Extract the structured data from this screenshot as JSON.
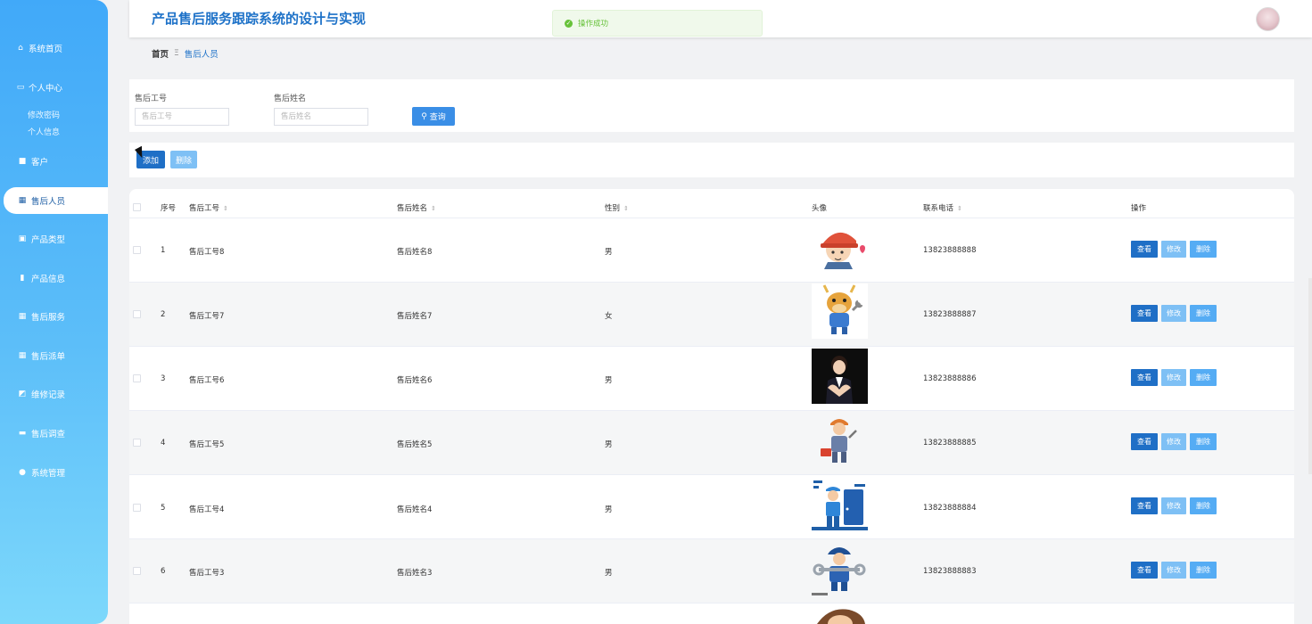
{
  "sidebar": {
    "home": "系统首页",
    "personal_center": "个人中心",
    "sub_items": [
      "修改密码",
      "个人信息"
    ],
    "items": [
      "客户",
      "售后人员",
      "产品类型",
      "产品信息",
      "售后服务",
      "售后派单",
      "维修记录",
      "售后调查",
      "系统管理"
    ],
    "active": "售后人员"
  },
  "header": {
    "title": "产品售后服务跟踪系统的设计与实现"
  },
  "toast": {
    "message": "操作成功"
  },
  "breadcrumb": {
    "home": "首页",
    "separator": "Ξ",
    "current": "售后人员"
  },
  "search": {
    "id_label": "售后工号",
    "id_placeholder": "售后工号",
    "id_value": "",
    "name_label": "售后姓名",
    "name_placeholder": "售后姓名",
    "name_value": "",
    "query_label": "查询"
  },
  "actions": {
    "add_label": "添加",
    "delete_label": "删除"
  },
  "table": {
    "columns": [
      "序号",
      "售后工号",
      "售后姓名",
      "性别",
      "头像",
      "联系电话",
      "操作"
    ],
    "rows": [
      {
        "index": "1",
        "id": "售后工号8",
        "name": "售后姓名8",
        "gender": "男",
        "phone": "13823888888",
        "avatar": "worker-helmet"
      },
      {
        "index": "2",
        "id": "售后工号7",
        "name": "售后姓名7",
        "gender": "女",
        "phone": "13823888887",
        "avatar": "bull-wrench"
      },
      {
        "index": "3",
        "id": "售后工号6",
        "name": "售后姓名6",
        "gender": "男",
        "phone": "13823888886",
        "avatar": "service-woman"
      },
      {
        "index": "4",
        "id": "售后工号5",
        "name": "售后姓名5",
        "gender": "男",
        "phone": "13823888885",
        "avatar": "repairman-toolbox"
      },
      {
        "index": "5",
        "id": "售后工号4",
        "name": "售后姓名4",
        "gender": "男",
        "phone": "13823888884",
        "avatar": "technician-door"
      },
      {
        "index": "6",
        "id": "售后工号3",
        "name": "售后姓名3",
        "gender": "男",
        "phone": "13823888883",
        "avatar": "mechanic-wrench"
      }
    ],
    "row_actions": {
      "view": "查看",
      "edit": "修改",
      "delete": "删除"
    }
  },
  "colors": {
    "primary": "#1f6fc6",
    "accent": "#3a8ee6",
    "title": "#1e72c8",
    "success": "#67c23a"
  }
}
